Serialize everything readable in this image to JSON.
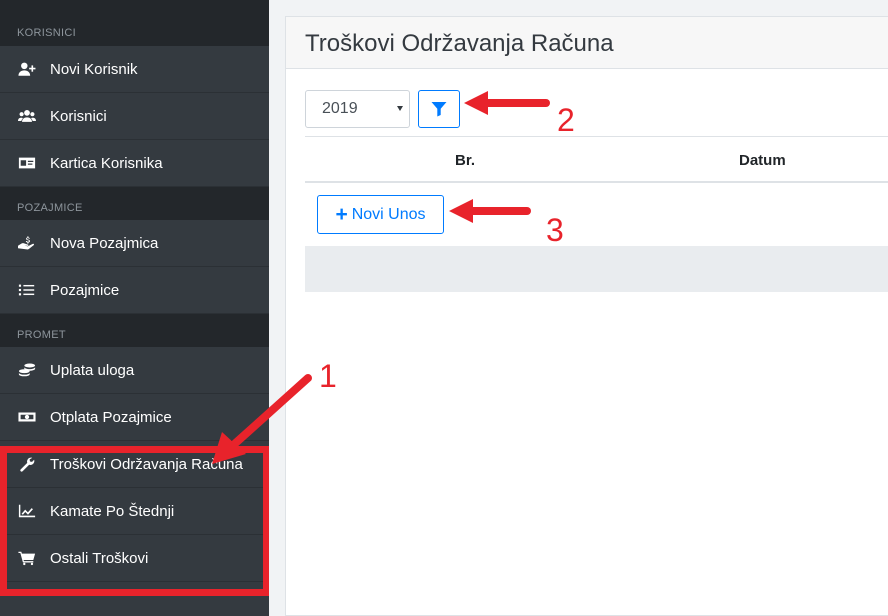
{
  "sidebar": {
    "sections": [
      {
        "header": "KORISNICI",
        "items": [
          {
            "label": "Novi Korisnik",
            "icon": "user-plus-icon"
          },
          {
            "label": "Korisnici",
            "icon": "users-icon"
          },
          {
            "label": "Kartica Korisnika",
            "icon": "id-card-icon"
          }
        ]
      },
      {
        "header": "POZAJMICE",
        "items": [
          {
            "label": "Nova Pozajmica",
            "icon": "hand-holding-dollar-icon"
          },
          {
            "label": "Pozajmice",
            "icon": "list-icon"
          }
        ]
      },
      {
        "header": "PROMET",
        "items": [
          {
            "label": "Uplata uloga",
            "icon": "coins-icon"
          },
          {
            "label": "Otplata Pozajmice",
            "icon": "money-bill-icon"
          },
          {
            "label": "Troškovi Održavanja Računa",
            "icon": "wrench-icon"
          },
          {
            "label": "Kamate Po Štednji",
            "icon": "chart-line-icon"
          },
          {
            "label": "Ostali Troškovi",
            "icon": "shopping-cart-icon"
          }
        ]
      }
    ]
  },
  "main": {
    "title": "Troškovi Održavanja Računa",
    "year_select": {
      "value": "2019"
    },
    "filter_button": {
      "icon": "filter-icon"
    },
    "table": {
      "columns": [
        "Br.",
        "Datum"
      ]
    },
    "new_entry_button": {
      "label": "Novi Unos",
      "icon": "plus-icon"
    }
  },
  "annotations": {
    "numbers": [
      "1",
      "2",
      "3"
    ],
    "color": "#e8232b"
  },
  "colors": {
    "sidebar_bg": "#343a40",
    "sidebar_header_bg": "#23272b",
    "primary": "#007bff",
    "highlight_red": "#e8232b"
  }
}
